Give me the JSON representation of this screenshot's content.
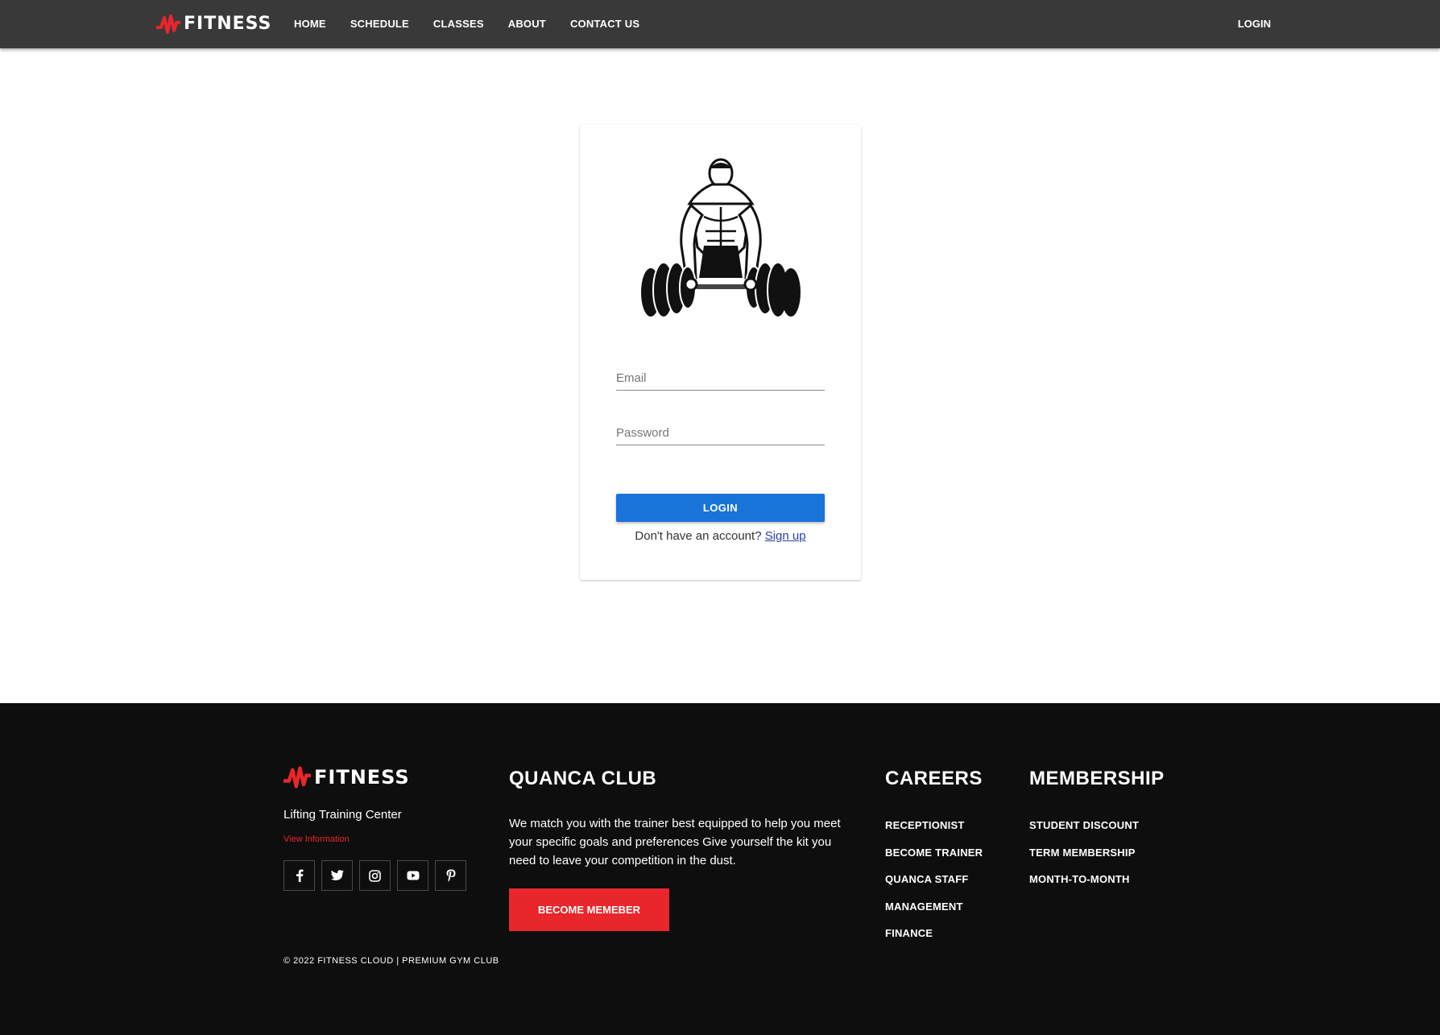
{
  "brand": {
    "logo_text": "FITNESS",
    "logo_icon": "zigzag-pulse-icon",
    "accent_color": "#e8262b",
    "nav_bg": "#3a393a",
    "primary_button_color": "#1a73d9",
    "footer_bg": "#0e0e0e"
  },
  "navbar": {
    "links": [
      {
        "label": "HOME"
      },
      {
        "label": "SCHEDULE"
      },
      {
        "label": "CLASSES"
      },
      {
        "label": "ABOUT"
      },
      {
        "label": "CONTACT US"
      }
    ],
    "login_label": "LOGIN"
  },
  "login_card": {
    "image": "weightlifter-deadlift-illustration",
    "email_placeholder": "Email",
    "email_value": "",
    "password_placeholder": "Password",
    "password_value": "",
    "login_button": "LOGIN",
    "no_account_text": "Don't have an account?",
    "signup_link": "Sign up"
  },
  "footer": {
    "logo_text": "FITNESS",
    "tagline": "Lifting Training Center",
    "view_info": "View Information",
    "socials": [
      {
        "icon": "facebook-icon",
        "glyph": "f"
      },
      {
        "icon": "twitter-icon",
        "glyph": ""
      },
      {
        "icon": "instagram-icon",
        "glyph": ""
      },
      {
        "icon": "youtube-icon",
        "glyph": ""
      },
      {
        "icon": "pinterest-icon",
        "glyph": "P"
      }
    ],
    "club": {
      "heading": "QUANCA CLUB",
      "description": "We match you with the trainer best equipped to help you meet your specific goals and preferences Give yourself the kit you need to leave your competition in the dust.",
      "cta": "BECOME MEMEBER"
    },
    "careers": {
      "heading": "CAREERS",
      "items": [
        "RECEPTIONIST",
        "BECOME TRAINER",
        "QUANCA STAFF",
        "MANAGEMENT",
        "FINANCE"
      ]
    },
    "membership": {
      "heading": "MEMBERSHIP",
      "items": [
        "STUDENT DISCOUNT",
        "TERM MEMBERSHIP",
        "MONTH-TO-MONTH"
      ]
    },
    "copyright": "© 2022 FITNESS CLOUD | PREMIUM GYM CLUB"
  }
}
